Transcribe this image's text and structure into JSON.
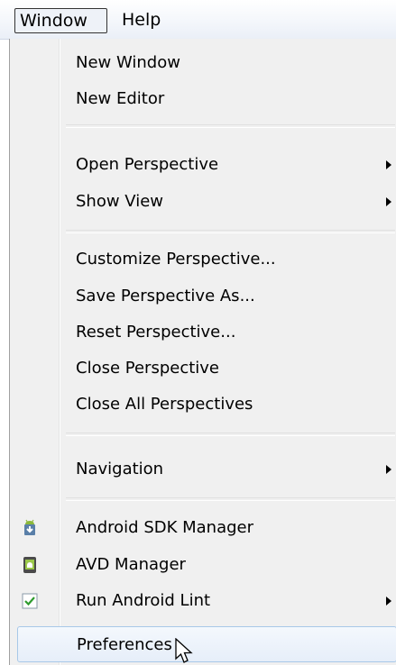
{
  "menubar": {
    "window_label": "Window",
    "help_label": "Help"
  },
  "menu": {
    "items": [
      {
        "label": "New Window"
      },
      {
        "label": "New Editor"
      },
      {
        "label": "Open Perspective",
        "submenu": true
      },
      {
        "label": "Show View",
        "submenu": true
      },
      {
        "label": "Customize Perspective..."
      },
      {
        "label": "Save Perspective As..."
      },
      {
        "label": "Reset Perspective..."
      },
      {
        "label": "Close Perspective"
      },
      {
        "label": "Close All Perspectives"
      },
      {
        "label": "Navigation",
        "submenu": true
      },
      {
        "label": "Android SDK Manager",
        "icon": "android-sdk-icon"
      },
      {
        "label": "AVD Manager",
        "icon": "avd-manager-icon"
      },
      {
        "label": "Run Android Lint",
        "icon": "lint-check-icon",
        "submenu": true
      },
      {
        "label": "Preferences",
        "highlighted": true
      }
    ]
  },
  "colors": {
    "menu_background": "#f0f0f0",
    "highlight_border": "#a8c8e8",
    "android_green": "#8bb83a",
    "check_green": "#2e9b2e"
  }
}
